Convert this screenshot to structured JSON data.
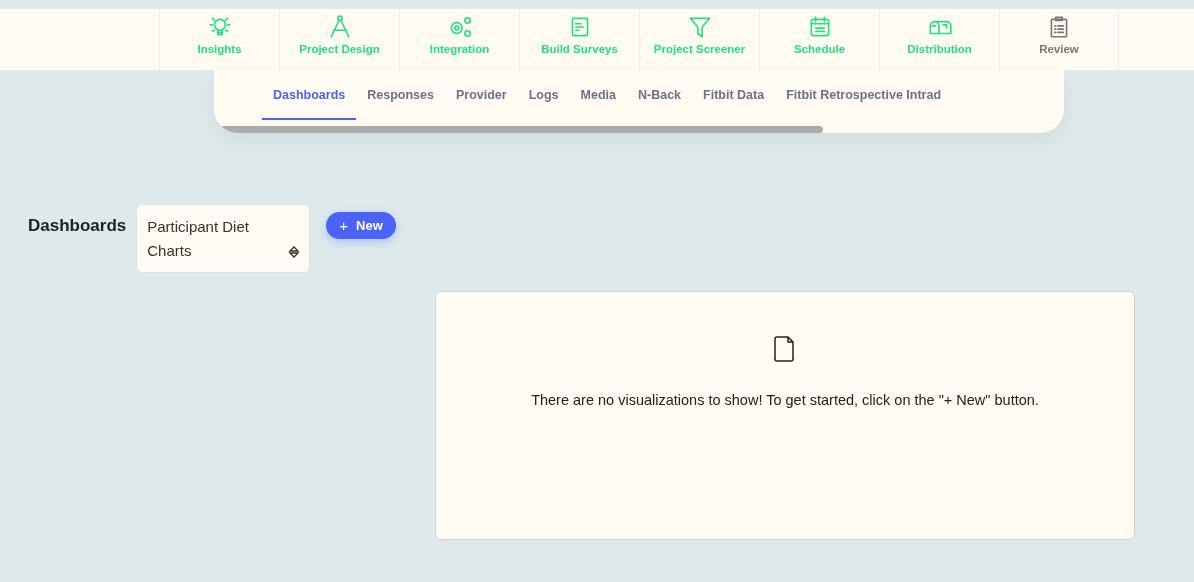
{
  "nav": [
    {
      "label": "Insights",
      "disabled": false
    },
    {
      "label": "Project Design",
      "disabled": false
    },
    {
      "label": "Integration",
      "disabled": false
    },
    {
      "label": "Build Surveys",
      "disabled": false
    },
    {
      "label": "Project Screener",
      "disabled": false
    },
    {
      "label": "Schedule",
      "disabled": false
    },
    {
      "label": "Distribution",
      "disabled": false
    },
    {
      "label": "Review",
      "disabled": true
    }
  ],
  "tabs": [
    {
      "label": "Dashboards",
      "selected": true
    },
    {
      "label": "Responses",
      "selected": false
    },
    {
      "label": "Provider",
      "selected": false
    },
    {
      "label": "Logs",
      "selected": false
    },
    {
      "label": "Media",
      "selected": false
    },
    {
      "label": "N-Back",
      "selected": false
    },
    {
      "label": "Fitbit Data",
      "selected": false
    },
    {
      "label": "Fitbit Retrospective Intrad",
      "selected": false
    }
  ],
  "heading": "Dashboards",
  "dashboard_select": {
    "value": "Participant Diet Charts"
  },
  "new_button": {
    "icon": "+",
    "label": "New"
  },
  "empty_message": "There are no visualizations to show! To get started, click on the \"+ New\" button."
}
